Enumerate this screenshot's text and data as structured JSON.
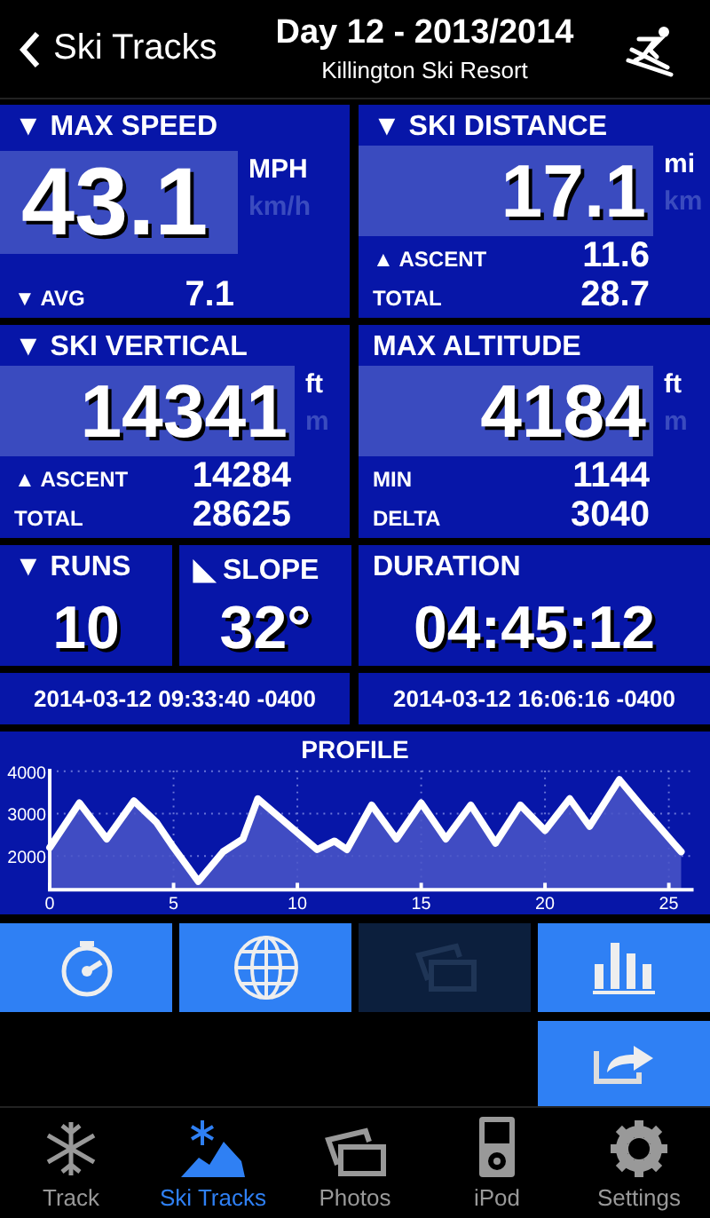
{
  "header": {
    "back_label": "Ski Tracks",
    "title": "Day 12 - 2013/2014",
    "subtitle": "Killington Ski Resort"
  },
  "stat_panels": [
    {
      "kind": "large",
      "title": "▼ MAX SPEED",
      "value": "43.1",
      "units": [
        {
          "label": "MPH",
          "selected": true
        },
        {
          "label": "km/h",
          "selected": false
        }
      ],
      "stats": [
        {
          "label": "▼ AVG",
          "value": "7.1"
        }
      ]
    },
    {
      "kind": "normal",
      "title": "▼ SKI DISTANCE",
      "value": "17.1",
      "units": [
        {
          "label": "mi",
          "selected": true
        },
        {
          "label": "km",
          "selected": false
        }
      ],
      "stats": [
        {
          "label": "▲ ASCENT",
          "value": "11.6"
        },
        {
          "label": "TOTAL",
          "value": "28.7"
        }
      ]
    },
    {
      "kind": "normal",
      "title": "▼ SKI VERTICAL",
      "value": "14341",
      "units": [
        {
          "label": "ft",
          "selected": true
        },
        {
          "label": "m",
          "selected": false
        }
      ],
      "stats": [
        {
          "label": "▲ ASCENT",
          "value": "14284"
        },
        {
          "label": "TOTAL",
          "value": "28625"
        }
      ]
    },
    {
      "kind": "normal",
      "title": "MAX ALTITUDE",
      "value": "4184",
      "units": [
        {
          "label": "ft",
          "selected": true
        },
        {
          "label": "m",
          "selected": false
        }
      ],
      "stats": [
        {
          "label": "MIN",
          "value": "1144"
        },
        {
          "label": "DELTA",
          "value": "3040"
        }
      ]
    }
  ],
  "count_panels": [
    {
      "title": "▼ RUNS",
      "value": "10"
    },
    {
      "title": "◣ SLOPE",
      "value": "32°"
    },
    {
      "title": "DURATION",
      "value": "04:45:12"
    }
  ],
  "timestamps": [
    "2014-03-12 09:33:40 -0400",
    "2014-03-12 16:06:16 -0400"
  ],
  "profile": {
    "title": "PROFILE",
    "chart_data": {
      "type": "area",
      "x": [
        0,
        1.2,
        2.3,
        3.4,
        4.3,
        5,
        6,
        7,
        7.8,
        8.4,
        9.5,
        10.8,
        11.5,
        12,
        13,
        14,
        15,
        16,
        17,
        18,
        19,
        20,
        21,
        21.8,
        23,
        24,
        25.5
      ],
      "series": [
        {
          "color": "#ffffff",
          "values": [
            2200,
            3250,
            2400,
            3300,
            2800,
            2200,
            1400,
            2100,
            2400,
            3350,
            2800,
            2150,
            2350,
            2150,
            3200,
            2400,
            3250,
            2400,
            3200,
            2300,
            3200,
            2600,
            3350,
            2700,
            3800,
            3100,
            2100
          ]
        }
      ],
      "grid": true,
      "xlim": [
        0,
        26
      ],
      "ylim": [
        1200,
        4100
      ],
      "xticks": [
        0,
        5,
        10,
        15,
        20,
        25
      ],
      "yticks": [
        2000,
        3000,
        4000
      ]
    }
  },
  "action_buttons": [
    {
      "kind": "stopwatch",
      "disabled": false
    },
    {
      "kind": "globe",
      "disabled": false
    },
    {
      "kind": "photos",
      "disabled": true
    },
    {
      "kind": "chart",
      "disabled": false
    },
    {
      "kind": "share",
      "disabled": false
    }
  ],
  "tabs": [
    {
      "kind": "snowflake",
      "label": "Track",
      "selected": false
    },
    {
      "kind": "ski",
      "label": "Ski Tracks",
      "selected": true
    },
    {
      "kind": "photos",
      "label": "Photos",
      "selected": false
    },
    {
      "kind": "ipod",
      "label": "iPod",
      "selected": false
    },
    {
      "kind": "gear",
      "label": "Settings",
      "selected": false
    }
  ]
}
